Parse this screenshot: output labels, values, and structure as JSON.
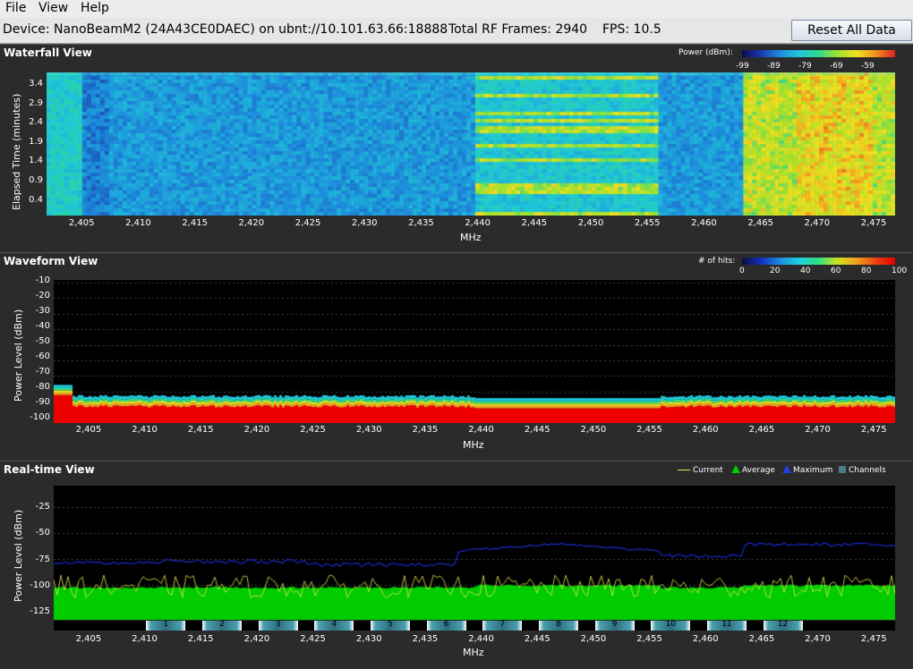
{
  "menu": [
    "File",
    "View",
    "Help"
  ],
  "info": {
    "device": "Device: NanoBeamM2 (24A43CE0DAEC) on ubnt://10.101.63.66:18888",
    "frames": "Total RF Frames: 2940",
    "fps": "FPS: 10.5",
    "reset_label": "Reset All Data"
  },
  "waterfall": {
    "title": "Waterfall View",
    "legend_label": "Power (dBm):",
    "legend_ticks": [
      "-99",
      "-89",
      "-79",
      "-69",
      "-59"
    ],
    "ylabel": "Elapsed Time (minutes)",
    "yticks": [
      "3.4",
      "2.9",
      "2.4",
      "1.9",
      "1.4",
      "0.9",
      "0.4"
    ],
    "xlabel": "MHz"
  },
  "waveform": {
    "title": "Waveform View",
    "legend_label": "# of hits:",
    "legend_ticks": [
      "0",
      "20",
      "40",
      "60",
      "80",
      "100"
    ],
    "ylabel": "Power Level (dBm)",
    "yticks": [
      "-10",
      "-20",
      "-30",
      "-40",
      "-50",
      "-60",
      "-70",
      "-80",
      "-90",
      "-100"
    ],
    "xlabel": "MHz"
  },
  "realtime": {
    "title": "Real-time View",
    "legend": [
      "Current",
      "Average",
      "Maximum",
      "Channels"
    ],
    "ylabel": "Power Level (dBm)",
    "yticks": [
      "-25",
      "-50",
      "-75",
      "-100",
      "-125"
    ],
    "xlabel": "MHz",
    "channels": [
      "1",
      "2",
      "3",
      "4",
      "5",
      "6",
      "7",
      "8",
      "9",
      "10",
      "11",
      "12"
    ]
  },
  "xticks": [
    "2,405",
    "2,410",
    "2,415",
    "2,420",
    "2,425",
    "2,430",
    "2,435",
    "2,440",
    "2,445",
    "2,450",
    "2,455",
    "2,460",
    "2,465",
    "2,470",
    "2,475"
  ],
  "colors": {
    "average": "#00cc00",
    "maximum": "#1a2bcc",
    "current": "#e8e84a",
    "channel": "#4aa0b0"
  }
}
